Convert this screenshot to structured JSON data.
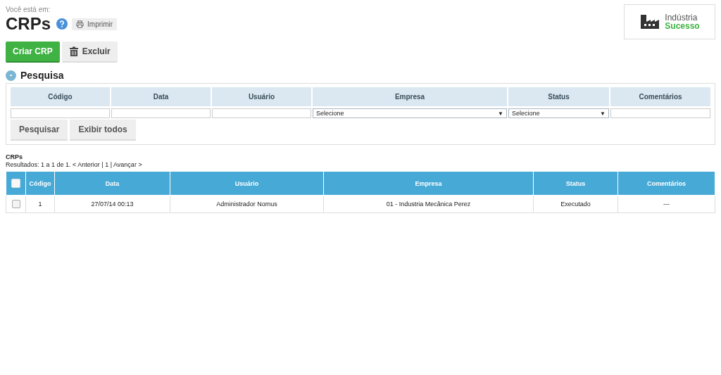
{
  "breadcrumb": "Você está em:",
  "title": "CRPs",
  "print_button": "Imprimir",
  "logo": {
    "line1": "Indústria",
    "line2": "Sucesso"
  },
  "actions": [
    {
      "label": "Criar CRP",
      "kind": "primary"
    },
    {
      "label": "Excluir",
      "kind": "delete"
    }
  ],
  "search": {
    "title": "Pesquisa",
    "toggle": "-",
    "expanded": true,
    "fields": [
      {
        "label": "Código",
        "kind": "text"
      },
      {
        "label": "Data",
        "kind": "text"
      },
      {
        "label": "Usuário",
        "kind": "text"
      },
      {
        "label": "Empresa",
        "kind": "select",
        "value": "Selecione",
        "arrow": "▼"
      },
      {
        "label": "Status",
        "kind": "select",
        "value": "Selecione",
        "arrow": "▼"
      },
      {
        "label": "Comentários",
        "kind": "text"
      }
    ],
    "buttons": [
      "Pesquisar",
      "Exibir todos"
    ]
  },
  "results": {
    "title": "CRPs",
    "pagination": "Resultados: 1 a 1 de 1. < Anterior | 1 | Avançar >",
    "select_all_checked": false,
    "columns": [
      "Código",
      "Data",
      "Usuário",
      "Empresa",
      "Status",
      "Comentários"
    ],
    "rows": [
      {
        "checked": false,
        "cells": [
          "1",
          "27/07/14 00:13",
          "Administrador Nomus",
          "01 - Industria Mecânica Perez",
          "Executado",
          "---"
        ]
      }
    ]
  }
}
